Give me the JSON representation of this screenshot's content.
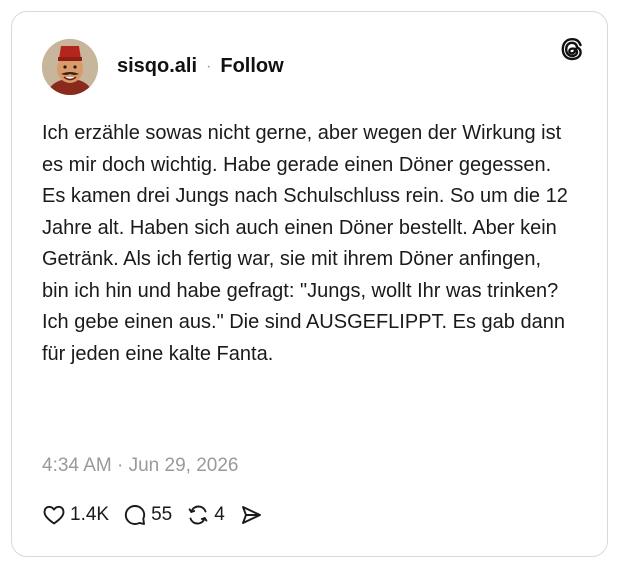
{
  "post": {
    "username": "sisqo.ali",
    "separator": "·",
    "follow_label": "Follow",
    "text": "Ich erzähle sowas nicht gerne, aber wegen der Wirkung ist es mir doch wichtig. Habe gerade einen Döner gegessen. Es kamen drei Jungs nach Schulschluss rein. So um die 12 Jahre alt. Haben sich auch einen Döner bestellt. Aber kein Getränk. Als ich fertig war, sie mit ihrem Döner anfingen, bin ich hin und habe gefragt: \"Jungs, wollt Ihr was trinken? Ich gebe einen aus.\" Die sind AUSGEFLIPPT. Es gab dann für jeden eine kalte Fanta.",
    "timestamp": "4:34 AM · Jun 29, 2026"
  },
  "actions": {
    "likes": "1.4K",
    "replies": "55",
    "reposts": "4"
  },
  "icons": {
    "brand": "threads-logo-icon",
    "like": "heart-icon",
    "reply": "speech-bubble-icon",
    "repost": "repost-icon",
    "share": "send-icon"
  }
}
